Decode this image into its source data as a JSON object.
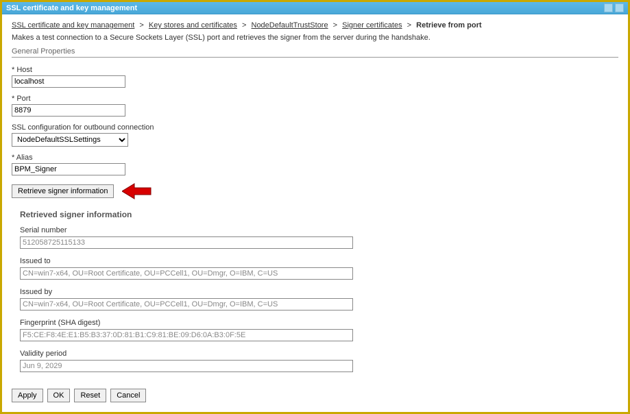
{
  "titlebar": {
    "title": "SSL certificate and key management"
  },
  "breadcrumb": {
    "items": [
      {
        "label": "SSL certificate and key management",
        "link": true
      },
      {
        "label": "Key stores and certificates",
        "link": true
      },
      {
        "label": "NodeDefaultTrustStore",
        "link": true
      },
      {
        "label": "Signer certificates",
        "link": true
      },
      {
        "label": "Retrieve from port",
        "link": false
      }
    ]
  },
  "description": "Makes a test connection to a Secure Sockets Layer (SSL) port and retrieves the signer from the server during the handshake.",
  "section": {
    "header": "General Properties"
  },
  "fields": {
    "host": {
      "label": "Host",
      "value": "localhost"
    },
    "port": {
      "label": "Port",
      "value": "8879"
    },
    "sslconf": {
      "label": "SSL configuration for outbound connection",
      "value": "NodeDefaultSSLSettings"
    },
    "alias": {
      "label": "Alias",
      "value": "BPM_Signer"
    }
  },
  "retrieve_button": "Retrieve signer information",
  "retrieved": {
    "header": "Retrieved signer information",
    "serial": {
      "label": "Serial number",
      "value": "512058725115133"
    },
    "issued_to": {
      "label": "Issued to",
      "value": "CN=win7-x64, OU=Root Certificate, OU=PCCell1, OU=Dmgr, O=IBM, C=US"
    },
    "issued_by": {
      "label": "Issued by",
      "value": "CN=win7-x64, OU=Root Certificate, OU=PCCell1, OU=Dmgr, O=IBM, C=US"
    },
    "fingerprint": {
      "label": "Fingerprint (SHA digest)",
      "value": "F5:CE:F8:4E:E1:B5:B3:37:0D:81:B1:C9:81:BE:09:D6:0A:B3:0F:5E"
    },
    "validity": {
      "label": "Validity period",
      "value": "Jun 9, 2029"
    }
  },
  "footer": {
    "apply": "Apply",
    "ok": "OK",
    "reset": "Reset",
    "cancel": "Cancel"
  }
}
